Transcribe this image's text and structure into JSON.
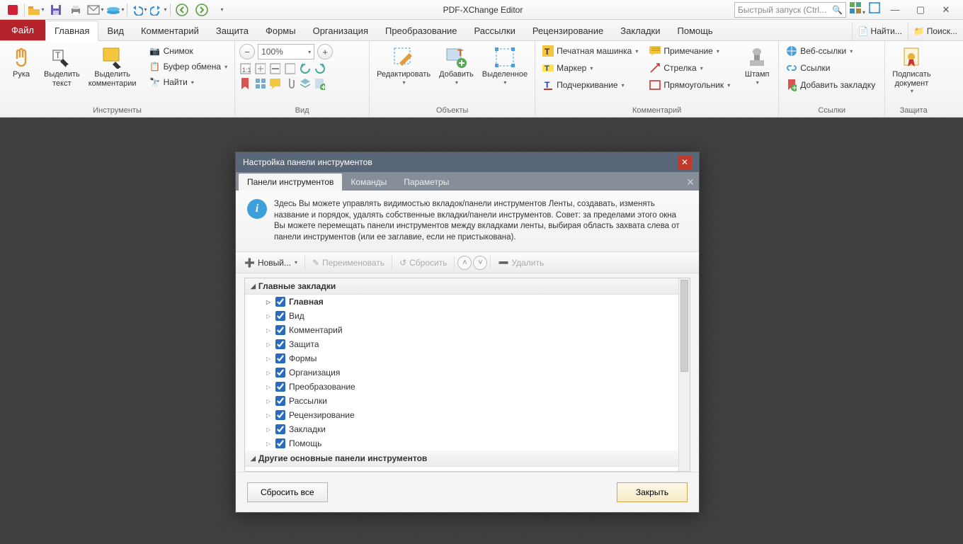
{
  "app": {
    "title": "PDF-XChange Editor"
  },
  "quicklaunch": {
    "placeholder": "Быстрый запуск (Ctrl..."
  },
  "tabs": {
    "file": "Файл",
    "items": [
      "Главная",
      "Вид",
      "Комментарий",
      "Защита",
      "Формы",
      "Организация",
      "Преобразование",
      "Рассылки",
      "Рецензирование",
      "Закладки",
      "Помощь"
    ],
    "right": {
      "find": "Найти...",
      "search": "Поиск..."
    }
  },
  "ribbon": {
    "tools": {
      "hand": "Рука",
      "seltext": "Выделить\nтекст",
      "selcomm": "Выделить\nкомментарии",
      "snapshot": "Снимок",
      "clipboard": "Буфер обмена",
      "find": "Найти",
      "label": "Инструменты"
    },
    "view": {
      "zoom": "100%",
      "label": "Вид"
    },
    "objects": {
      "edit": "Редактировать",
      "add": "Добавить",
      "selected": "Выделенное",
      "label": "Объекты"
    },
    "comment": {
      "typewriter": "Печатная машинка",
      "note": "Примечание",
      "highlight": "Маркер",
      "arrow": "Стрелка",
      "underline": "Подчеркивание",
      "rect": "Прямоугольник",
      "stamp": "Штамп",
      "label": "Комментарий"
    },
    "links": {
      "weblinks": "Веб-ссылки",
      "links": "Ссылки",
      "addbm": "Добавить закладку",
      "label": "Ссылки"
    },
    "protect": {
      "sign": "Подписать\nдокумент",
      "label": "Защита"
    }
  },
  "dialog": {
    "title": "Настройка панели инструментов",
    "tabs": [
      "Панели инструментов",
      "Команды",
      "Параметры"
    ],
    "info": "Здесь Вы можете управлять видимостью вкладок/панели инструментов Ленты, создавать,  изменять название и порядок, удалять собственные вкладки/панели инструментов. Совет: за пределами этого окна Вы можете перемещать панели инструментов между вкладками ленты, выбирая область захвата слева от панели инструментов (или ее заглавие, если не пристыкована).",
    "toolbar": {
      "new": "Новый...",
      "rename": "Переименовать",
      "reset": "Сбросить",
      "delete": "Удалить"
    },
    "tree": {
      "header": "Главные закладки",
      "items": [
        "Главная",
        "Вид",
        "Комментарий",
        "Защита",
        "Формы",
        "Организация",
        "Преобразование",
        "Рассылки",
        "Рецензирование",
        "Закладки",
        "Помощь"
      ],
      "footer": "Другие основные панели инструментов"
    },
    "buttons": {
      "resetall": "Сбросить все",
      "close": "Закрыть"
    }
  }
}
